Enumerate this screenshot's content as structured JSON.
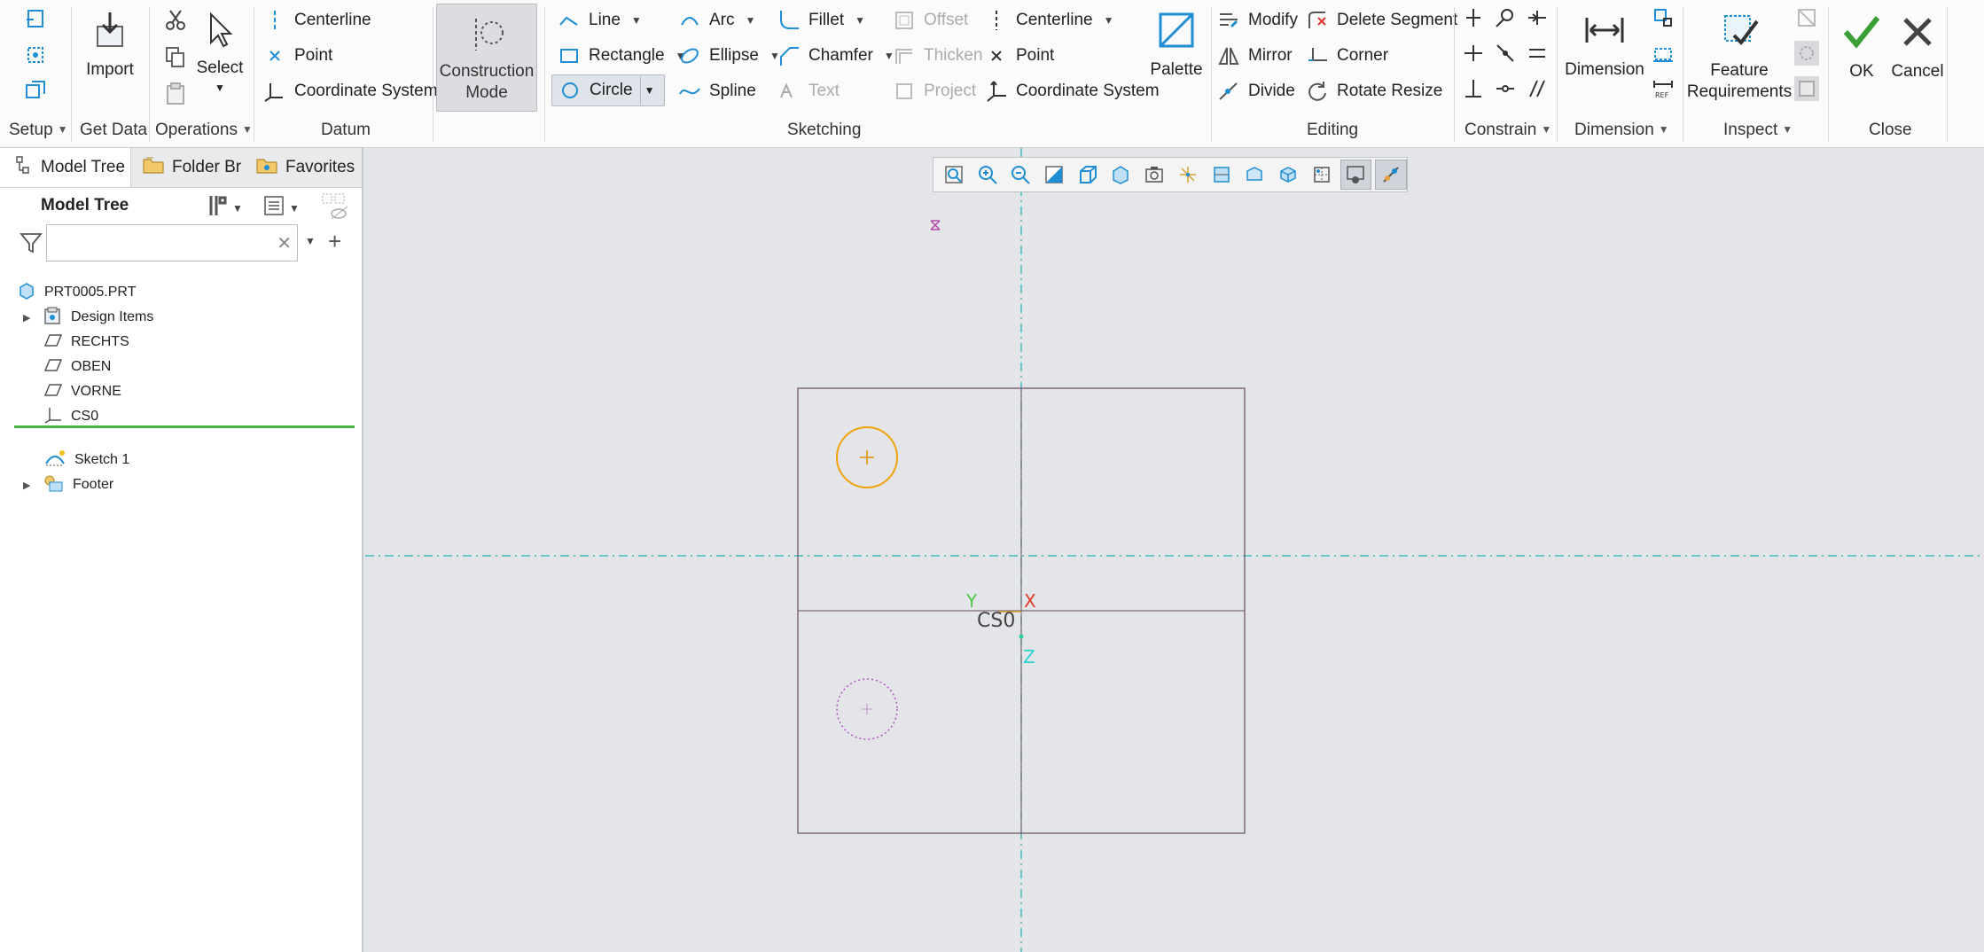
{
  "ribbon": {
    "groups": {
      "setup": "Setup",
      "get_data": "Get Data",
      "operations": "Operations",
      "datum": "Datum",
      "sketching": "Sketching",
      "editing": "Editing",
      "constrain": "Constrain",
      "dimension": "Dimension",
      "inspect": "Inspect",
      "close": "Close"
    },
    "get_data": {
      "import": "Import"
    },
    "operations": {
      "select": "Select"
    },
    "datum": {
      "centerline": "Centerline",
      "point": "Point",
      "coordinate_system": "Coordinate System"
    },
    "sketching": {
      "construction_mode": "Construction Mode",
      "line": "Line",
      "rectangle": "Rectangle",
      "circle": "Circle",
      "arc": "Arc",
      "ellipse": "Ellipse",
      "spline": "Spline",
      "fillet": "Fillet",
      "chamfer": "Chamfer",
      "text": "Text",
      "offset": "Offset",
      "thicken": "Thicken",
      "project": "Project",
      "centerline": "Centerline",
      "point": "Point",
      "coordinate_system": "Coordinate System",
      "palette": "Palette"
    },
    "editing": {
      "modify": "Modify",
      "mirror": "Mirror",
      "divide": "Divide",
      "delete_segment": "Delete Segment",
      "corner": "Corner",
      "rotate_resize": "Rotate Resize"
    },
    "dimension": {
      "dimension": "Dimension"
    },
    "inspect": {
      "feature_requirements": "Feature Requirements"
    },
    "close": {
      "ok": "OK",
      "cancel": "Cancel"
    }
  },
  "left_panel": {
    "tabs": [
      "Model Tree",
      "Folder Br",
      "Favorites"
    ],
    "title": "Model Tree",
    "search_value": "",
    "tree": [
      {
        "label": "PRT0005.PRT",
        "icon": "part-icon"
      },
      {
        "label": "Design Items",
        "icon": "design-items-icon",
        "expandable": true
      },
      {
        "label": "RECHTS",
        "icon": "datum-plane-icon"
      },
      {
        "label": "OBEN",
        "icon": "datum-plane-icon"
      },
      {
        "label": "VORNE",
        "icon": "datum-plane-icon"
      },
      {
        "label": "CS0",
        "icon": "csys-icon"
      },
      {
        "label": "Sketch 1",
        "icon": "sketch-icon"
      },
      {
        "label": "Footer",
        "icon": "footer-icon",
        "expandable": true
      }
    ]
  },
  "canvas": {
    "csys_label": "CS0",
    "axis_x": "X",
    "axis_y": "Y",
    "axis_z": "Z"
  },
  "colors": {
    "accent_blue": "#1f8ed4",
    "sketch_orange": "#f0a30a",
    "construction_purple": "#b44fc8",
    "geometry_line": "#7d6a78",
    "ok_green": "#3aa036"
  }
}
